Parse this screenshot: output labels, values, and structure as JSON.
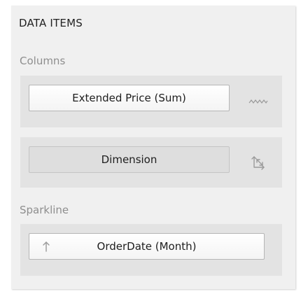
{
  "panel": {
    "title": "DATA ITEMS"
  },
  "columns": {
    "label": "Columns",
    "items": [
      {
        "label": "Extended Price (Sum)",
        "icon": "sparkline-icon"
      },
      {
        "label": "Dimension",
        "icon": "swap-axes-icon"
      }
    ]
  },
  "sparkline": {
    "label": "Sparkline",
    "item": {
      "label": "OrderDate (Month)",
      "icon": "sort-ascending-icon"
    }
  },
  "colors": {
    "panel_bg": "#f0f0f0",
    "slot_bg": "#e3e3e3",
    "label_gray": "#8e8e8e",
    "icon_gray": "#9a9a9a"
  }
}
